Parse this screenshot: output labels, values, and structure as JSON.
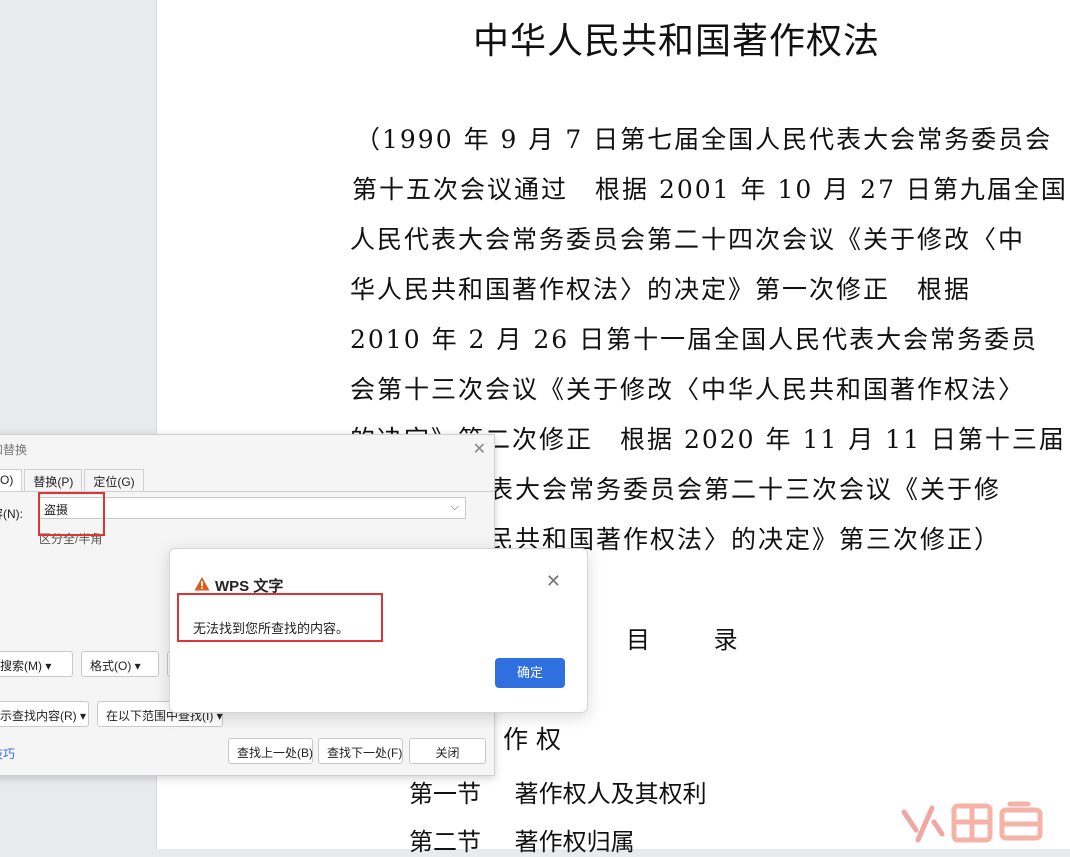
{
  "document": {
    "title": "中华人民共和国著作权法",
    "preamble_lines": [
      "（1990 年 9 月 7 日第七届全国人民代表大会常务委员会",
      "第十五次会议通过　根据 2001 年 10 月 27 日第九届全国",
      "人民代表大会常务委员会第二十四次会议《关于修改〈中",
      "华人民共和国著作权法〉的决定》第一次修正　根据",
      "2010 年 2 月 26 日第十一届全国人民代表大会常务委员",
      "会第十三次会议《关于修改〈中华人民共和国著作权法〉",
      "的决定》第二次修正　根据 2020 年 11 月 11 日第十三届",
      "表大会常务委员会第二十三次会议《关于修",
      "民共和国著作权法〉的决定》第三次修正）"
    ],
    "toc_title": [
      "目",
      "录"
    ],
    "chapter_fragment": "作 权",
    "sections": [
      {
        "num": "第一节",
        "title": "著作权人及其权利"
      },
      {
        "num": "第二节",
        "title": "著作权归属"
      }
    ]
  },
  "find_dialog": {
    "title": "和替换",
    "tabs": [
      "O)",
      "替换(P)",
      "定位(G)"
    ],
    "find_label": "容(N):",
    "find_value": "盗摄",
    "option_text": "区分全/半角",
    "buttons": {
      "search": "搜索(M) ▾",
      "format": "格式(O) ▾",
      "highlight": "示查找内容(R) ▾",
      "scope": "在以下范围中查找(I) ▾",
      "find_prev": "查找上一处(B)",
      "find_next": "查找下一处(F)",
      "close": "关闭"
    },
    "tips_link": "技巧"
  },
  "alert": {
    "title": "WPS 文字",
    "message": "无法找到您所查找的内容。",
    "ok_label": "确定",
    "icon": "warning-triangle-icon",
    "colors": {
      "ok_button": "#2f6fe0",
      "warning_icon": "#e05a1a",
      "highlight_box": "#e03434"
    }
  }
}
